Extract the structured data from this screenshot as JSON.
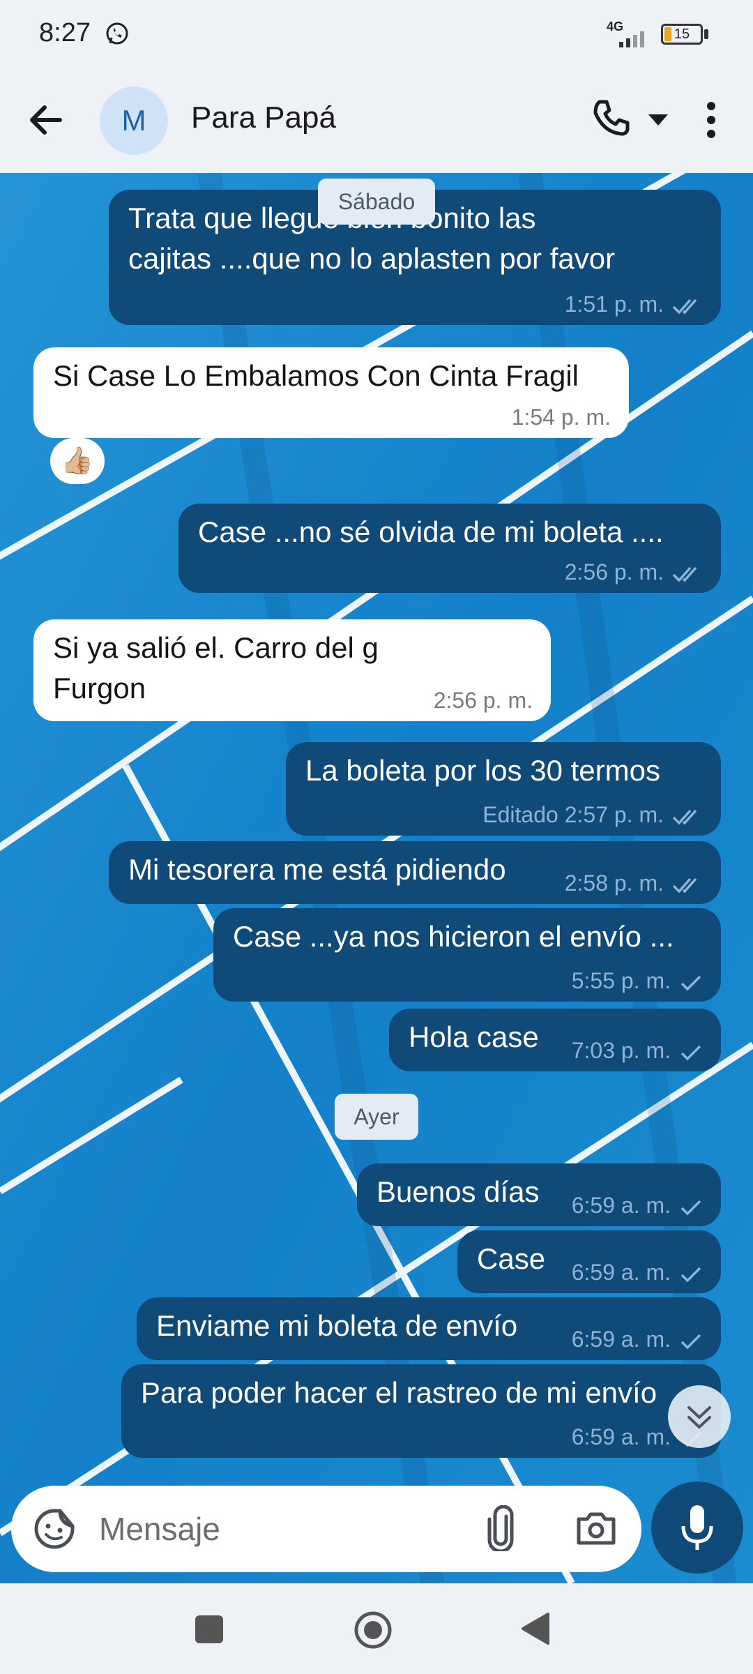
{
  "status_bar": {
    "time": "8:27",
    "network": "4G",
    "battery": "15"
  },
  "header": {
    "avatar_letter": "M",
    "contact_name": "Para Papá"
  },
  "dates": {
    "saturday": "Sábado",
    "yesterday": "Ayer"
  },
  "messages": [
    {
      "dir": "out",
      "text": "Trata que llegue bien bonito las\ncajitas ....que no lo aplasten por favor",
      "time": "1:51 p. m.",
      "status": "read"
    },
    {
      "dir": "in",
      "text": "Si Case Lo Embalamos Con Cinta Fragil",
      "time": "1:54 p. m.",
      "reaction": "👍🏼"
    },
    {
      "dir": "out",
      "text": "Case ...no sé olvida de mi boleta ....",
      "time": "2:56 p. m.",
      "status": "read"
    },
    {
      "dir": "in",
      "text": "Si ya salió el. Carro del g\nFurgon",
      "time": "2:56 p. m."
    },
    {
      "dir": "out",
      "text": "La boleta por los 30 termos",
      "time": "Editado 2:57 p. m.",
      "status": "read"
    },
    {
      "dir": "out",
      "text": "Mi tesorera me está pidiendo",
      "time": "2:58 p. m.",
      "status": "read"
    },
    {
      "dir": "out",
      "text": "Case ...ya nos hicieron el envío ...",
      "time": "5:55 p. m.",
      "status": "sent"
    },
    {
      "dir": "out",
      "text": "Hola case",
      "time": "7:03 p. m.",
      "status": "sent"
    },
    {
      "dir": "out",
      "text": "Buenos días",
      "time": "6:59 a. m.",
      "status": "sent"
    },
    {
      "dir": "out",
      "text": "Case",
      "time": "6:59 a. m.",
      "status": "sent"
    },
    {
      "dir": "out",
      "text": "Enviame mi boleta de envío",
      "time": "6:59 a. m.",
      "status": "sent"
    },
    {
      "dir": "out",
      "text": "Para poder hacer el rastreo de mi envío",
      "time": "6:59 a. m.",
      "status": "sent"
    }
  ],
  "compose": {
    "placeholder": "Mensaje"
  },
  "colors": {
    "outgoing_bubble": "#0f4a79",
    "incoming_bubble": "#ffffff",
    "accent": "#1e62a8",
    "chat_background": "#1f8fd6"
  },
  "icons": [
    "whatsapp-icon",
    "back-arrow-icon",
    "phone-icon",
    "dropdown-icon",
    "more-icon",
    "emoji-sticker-icon",
    "paperclip-icon",
    "camera-icon",
    "microphone-icon",
    "scroll-down-icon",
    "read-ticks-icon",
    "sent-tick-icon"
  ]
}
